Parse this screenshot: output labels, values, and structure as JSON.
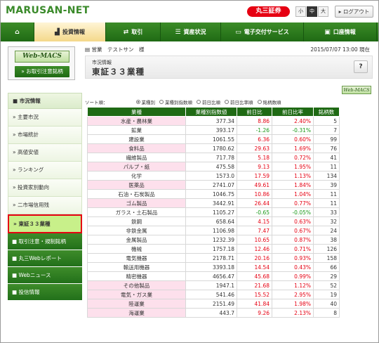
{
  "header": {
    "logo": "MARUSAN-NET",
    "brand": "丸三証券",
    "font_sizes": [
      "小",
      "中",
      "大"
    ],
    "logout": "ログアウト"
  },
  "nav": [
    {
      "icon": "home-icon",
      "glyph": "⌂",
      "label": ""
    },
    {
      "icon": "chart-icon",
      "glyph": "▟",
      "label": "投資情報",
      "active": true
    },
    {
      "icon": "exchange-icon",
      "glyph": "⇄",
      "label": "取引"
    },
    {
      "icon": "coins-icon",
      "glyph": "☰",
      "label": "資産状況"
    },
    {
      "icon": "monitor-icon",
      "glyph": "▭",
      "label": "電子交付サービス"
    },
    {
      "icon": "account-icon",
      "glyph": "▣",
      "label": "口座情報"
    }
  ],
  "sidebar": {
    "macs_logo": "Web-MACS",
    "macs_button": "» お取引注意銘柄",
    "section": "市況情報",
    "items": [
      "» 主要市況",
      "» 市場統計",
      "» 高値安値",
      "» ランキング",
      "» 投資家別動向",
      "» 二市場信用残"
    ],
    "active": "» 東証３３業種",
    "groups": [
      "取引注意・規制銘柄",
      "丸三Webレポート",
      "Webニュース",
      "投信情報"
    ]
  },
  "main": {
    "account": "営業　テストサン　様",
    "datetime": "2015/07/07 13:00 現在",
    "subtitle": "市況情報",
    "title": "東証３３業種",
    "help": "?",
    "macs_small": "Web-MACS",
    "sort_label": "ソート順：",
    "sort_options": [
      "業種別",
      "業種別指数順",
      "前日比順",
      "前日比率順",
      "銘柄数順"
    ],
    "columns": [
      "業種",
      "業種別指数値",
      "前日比",
      "前日比率",
      "銘柄数"
    ],
    "rows": [
      {
        "name": "水産・農林業",
        "index": "377.34",
        "chg": "8.86",
        "pct": "2.40%",
        "count": "5",
        "dir": "up",
        "pink": true
      },
      {
        "name": "鉱業",
        "index": "393.17",
        "chg": "-1.26",
        "pct": "-0.31%",
        "count": "7",
        "dir": "dn",
        "pink": false
      },
      {
        "name": "建設業",
        "index": "1061.55",
        "chg": "6.36",
        "pct": "0.60%",
        "count": "99",
        "dir": "up",
        "pink": false
      },
      {
        "name": "食料品",
        "index": "1780.62",
        "chg": "29.63",
        "pct": "1.69%",
        "count": "76",
        "dir": "up",
        "pink": true
      },
      {
        "name": "繊維製品",
        "index": "717.78",
        "chg": "5.18",
        "pct": "0.72%",
        "count": "41",
        "dir": "up",
        "pink": false
      },
      {
        "name": "パルプ・紙",
        "index": "475.58",
        "chg": "9.13",
        "pct": "1.95%",
        "count": "11",
        "dir": "up",
        "pink": true
      },
      {
        "name": "化学",
        "index": "1573.0",
        "chg": "17.59",
        "pct": "1.13%",
        "count": "134",
        "dir": "up",
        "pink": false
      },
      {
        "name": "医薬品",
        "index": "2741.07",
        "chg": "49.61",
        "pct": "1.84%",
        "count": "39",
        "dir": "up",
        "pink": true
      },
      {
        "name": "石油・石炭製品",
        "index": "1046.75",
        "chg": "10.86",
        "pct": "1.04%",
        "count": "11",
        "dir": "up",
        "pink": false
      },
      {
        "name": "ゴム製品",
        "index": "3442.91",
        "chg": "26.44",
        "pct": "0.77%",
        "count": "11",
        "dir": "up",
        "pink": true
      },
      {
        "name": "ガラス・土石製品",
        "index": "1105.27",
        "chg": "-0.65",
        "pct": "-0.05%",
        "count": "33",
        "dir": "dn",
        "pink": false
      },
      {
        "name": "鉄鋼",
        "index": "658.64",
        "chg": "4.15",
        "pct": "0.63%",
        "count": "32",
        "dir": "up",
        "pink": false
      },
      {
        "name": "非鉄金属",
        "index": "1106.98",
        "chg": "7.47",
        "pct": "0.67%",
        "count": "24",
        "dir": "up",
        "pink": false
      },
      {
        "name": "金属製品",
        "index": "1232.39",
        "chg": "10.65",
        "pct": "0.87%",
        "count": "38",
        "dir": "up",
        "pink": false
      },
      {
        "name": "機械",
        "index": "1757.18",
        "chg": "12.46",
        "pct": "0.71%",
        "count": "126",
        "dir": "up",
        "pink": false
      },
      {
        "name": "電気機器",
        "index": "2178.71",
        "chg": "20.16",
        "pct": "0.93%",
        "count": "158",
        "dir": "up",
        "pink": false
      },
      {
        "name": "輸送用機器",
        "index": "3393.18",
        "chg": "14.54",
        "pct": "0.43%",
        "count": "66",
        "dir": "up",
        "pink": false
      },
      {
        "name": "精密機器",
        "index": "4656.47",
        "chg": "45.68",
        "pct": "0.99%",
        "count": "29",
        "dir": "up",
        "pink": false
      },
      {
        "name": "その他製品",
        "index": "1947.1",
        "chg": "21.68",
        "pct": "1.12%",
        "count": "52",
        "dir": "up",
        "pink": true
      },
      {
        "name": "電気・ガス業",
        "index": "541.46",
        "chg": "15.52",
        "pct": "2.95%",
        "count": "19",
        "dir": "up",
        "pink": true
      },
      {
        "name": "陸運業",
        "index": "2151.49",
        "chg": "41.84",
        "pct": "1.98%",
        "count": "40",
        "dir": "up",
        "pink": true
      },
      {
        "name": "海運業",
        "index": "443.7",
        "chg": "9.26",
        "pct": "2.13%",
        "count": "8",
        "dir": "up",
        "pink": true
      }
    ]
  },
  "colors": {
    "green": "#1f6a14",
    "red": "#e60012",
    "up": "#e60012",
    "down": "#1a9a1a",
    "pink": "#fde0ec"
  }
}
